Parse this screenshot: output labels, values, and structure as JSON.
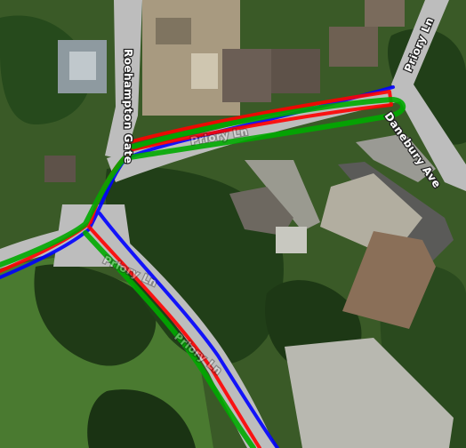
{
  "map": {
    "type": "aerial-satellite",
    "street_labels": {
      "roehampton_gate": "Roehampton Gate",
      "priory_ln": "Priory Ln",
      "danebury_ave": "Danebury Ave",
      "priory_ln_faded_1": "Priory Ln",
      "priory_ln_faded_2": "Priory Ln",
      "priory_ln_faded_3": "Priory Ln"
    },
    "tracks": [
      {
        "color": "#0000ff"
      },
      {
        "color": "#ff0000"
      },
      {
        "color": "#00aa00"
      }
    ],
    "colors": {
      "road": "#bdbdbd",
      "grass": "#3f6b2a",
      "trees": "#1f3f18",
      "parking_lot": "#b8b8b0",
      "dirt_field": "#8a6f58"
    }
  }
}
